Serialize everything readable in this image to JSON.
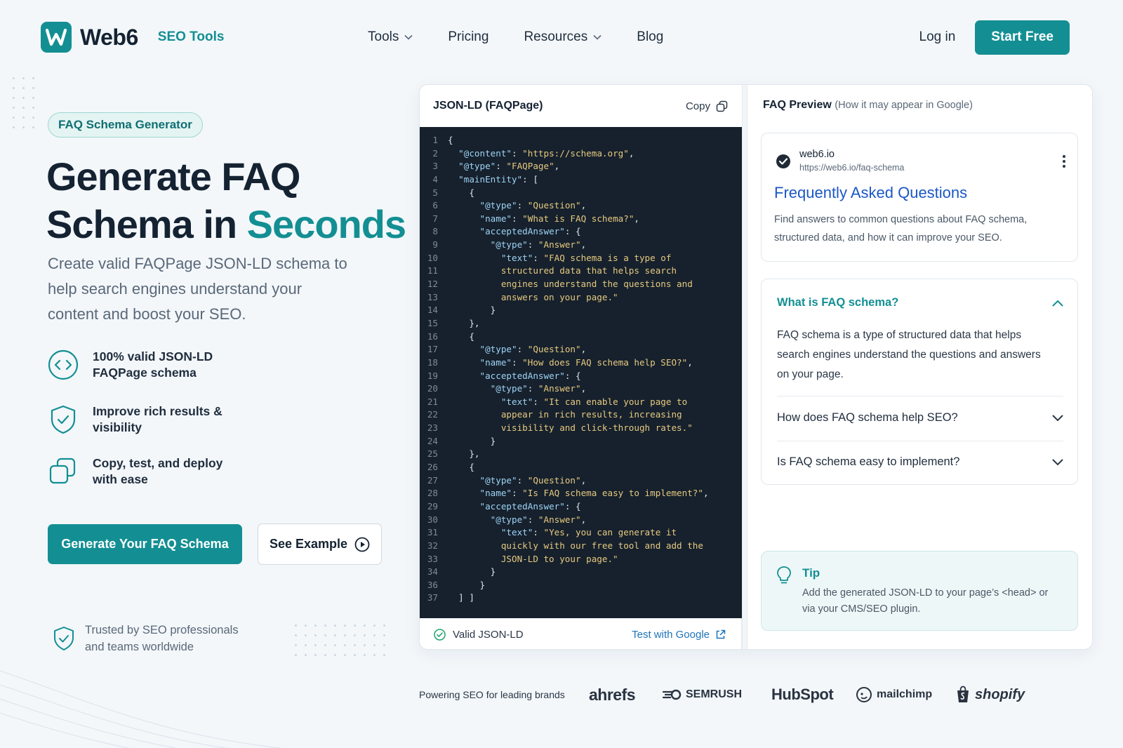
{
  "colors": {
    "accent": "#138f93",
    "ink": "#142232",
    "code_bg": "#16212d",
    "link": "#1a57c7"
  },
  "nav": {
    "logo_letter": "W",
    "brand": "Web6",
    "product": "SEO Tools",
    "links": [
      {
        "label": "Tools",
        "has_menu": true
      },
      {
        "label": "Pricing",
        "has_menu": false
      },
      {
        "label": "Resources",
        "has_menu": true
      },
      {
        "label": "Blog",
        "has_menu": false
      }
    ],
    "login": "Log in",
    "cta": "Start Free"
  },
  "hero": {
    "badge": "FAQ Schema Generator",
    "title_line1": "Generate FAQ",
    "title_line2_plain": "Schema in ",
    "title_line2_accent": "Seconds",
    "lede": "Create valid FAQPage JSON-LD schema to help search engines understand your content and boost your SEO.",
    "features": [
      {
        "icon": "code-brackets-icon",
        "text": "100% valid JSON-LD FAQPage schema"
      },
      {
        "icon": "shield-check-icon",
        "text": "Improve rich results & visibility"
      },
      {
        "icon": "copy-icon",
        "text": "Copy, test, and deploy with ease"
      }
    ],
    "primary_button": "Generate Your FAQ Schema",
    "secondary_button": "See Example",
    "trusted": "Trusted by SEO professionals and teams worldwide"
  },
  "code_panel": {
    "title": "JSON-LD (FAQPage)",
    "copy_label": "Copy",
    "lines": [
      "{",
      "  \"@content\": \"https://schema.org\",",
      "  \"@type\": \"FAQPage\",",
      "  \"mainEntity\": [",
      "    {",
      "      \"@type\": \"Question\",",
      "      \"name\": \"What is FAQ schema?\",",
      "      \"acceptedAnswer\": {",
      "        \"@type\": \"Answer\",",
      "          \"text\": \"FAQ schema is a type of",
      "          structured data that helps search",
      "          engines understand the questions and",
      "          answers on your page.\"",
      "        }",
      "    },",
      "    {",
      "      \"@type\": \"Question\",",
      "      \"name\": \"How does FAQ schema help SEO?\",",
      "      \"acceptedAnswer\": {",
      "        \"@type\": \"Answer\",",
      "          \"text\": \"It can enable your page to",
      "          appear in rich results, increasing",
      "          visibility and click-through rates.\"",
      "        }",
      "    },",
      "    {",
      "      \"@type\": \"Question\",",
      "      \"name\": \"Is FAQ schema easy to implement?\",",
      "      \"acceptedAnswer\": {",
      "        \"@type\": \"Answer\",",
      "          \"text\": \"Yes, you can generate it",
      "          quickly with our free tool and add the",
      "          JSON-LD to your page.\"",
      "        }",
      "      }",
      "  ] ]"
    ],
    "line_numbers": [
      "1",
      "2",
      "3",
      "4",
      "5",
      "6",
      "7",
      "8",
      "9",
      "10",
      "11",
      "12",
      "13",
      "14",
      "15",
      "16",
      "17",
      "18",
      "19",
      "20",
      "21",
      "22",
      "23",
      "24",
      "25",
      "26",
      "27",
      "28",
      "29",
      "30",
      "31",
      "32",
      "33",
      "34",
      "36",
      "37"
    ],
    "valid_label": "Valid JSON-LD",
    "test_label": "Test with Google"
  },
  "preview": {
    "title": "FAQ Preview",
    "subtitle": "(How it may appear in Google)",
    "serp": {
      "site": "web6.io",
      "url": "https://web6.io/faq-schema",
      "title": "Frequently Asked Questions",
      "description": "Find answers to common questions about FAQ schema, structured data, and how it can improve your SEO."
    },
    "faq": [
      {
        "q": "What is FAQ schema?",
        "a": "FAQ schema is a type of structured data that helps search engines understand the questions and answers on your page.",
        "open": true
      },
      {
        "q": "How does FAQ schema help SEO?",
        "open": false
      },
      {
        "q": "Is FAQ schema easy to implement?",
        "open": false
      }
    ],
    "tip": {
      "title": "Tip",
      "text": "Add the generated JSON-LD to your page’s <head> or via your CMS/SEO plugin."
    }
  },
  "brands": {
    "label": "Powering SEO for leading brands",
    "logos": [
      "ahrefs",
      "SEMRUSH",
      "HubSpot",
      "mailchimp",
      "shopify"
    ]
  }
}
